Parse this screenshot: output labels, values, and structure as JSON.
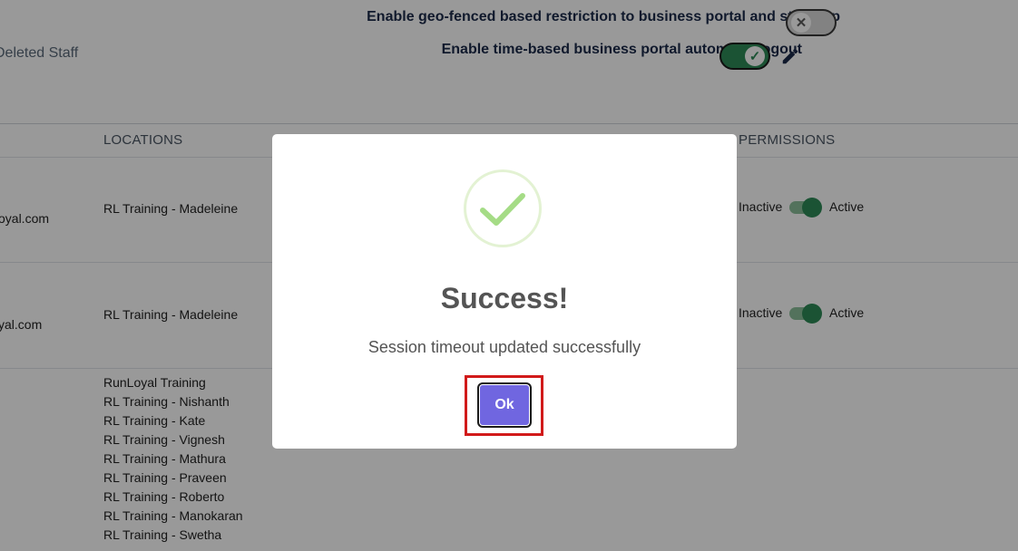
{
  "header": {
    "deleted_staff_tab": "Deleted Staff",
    "settings": {
      "geo_label": "Enable geo-fenced based restriction to business portal and staff app",
      "geo_enabled": false,
      "timeout_label": "Enable time-based business portal automatic logout",
      "timeout_enabled": true
    }
  },
  "table": {
    "columns": {
      "locations": "LOCATIONS",
      "permissions": "PERMISSIONS"
    },
    "rows": [
      {
        "email_fragment": "oyal.com",
        "location": "RL Training - Madeleine",
        "inactive_label": "Inactive",
        "active_label": "Active",
        "status": "Active"
      },
      {
        "email_fragment": "yal.com",
        "location": "RL Training - Madeleine",
        "inactive_label": "Inactive",
        "active_label": "Active",
        "status": "Active"
      }
    ],
    "third_row_locations": [
      "RunLoyal Training",
      "RL Training - Nishanth",
      "RL Training - Kate",
      "RL Training - Vignesh",
      "RL Training - Mathura",
      "RL Training - Praveen",
      "RL Training - Roberto",
      "RL Training - Manokaran",
      "RL Training - Swetha"
    ]
  },
  "modal": {
    "icon": "success-check-icon",
    "title": "Success!",
    "message": "Session timeout updated successfully",
    "ok_label": "Ok"
  },
  "colors": {
    "accent_button": "#7066e0",
    "success_green": "#2e8b57",
    "highlight_red": "#d11a1a",
    "check_green": "#a5dc86"
  }
}
